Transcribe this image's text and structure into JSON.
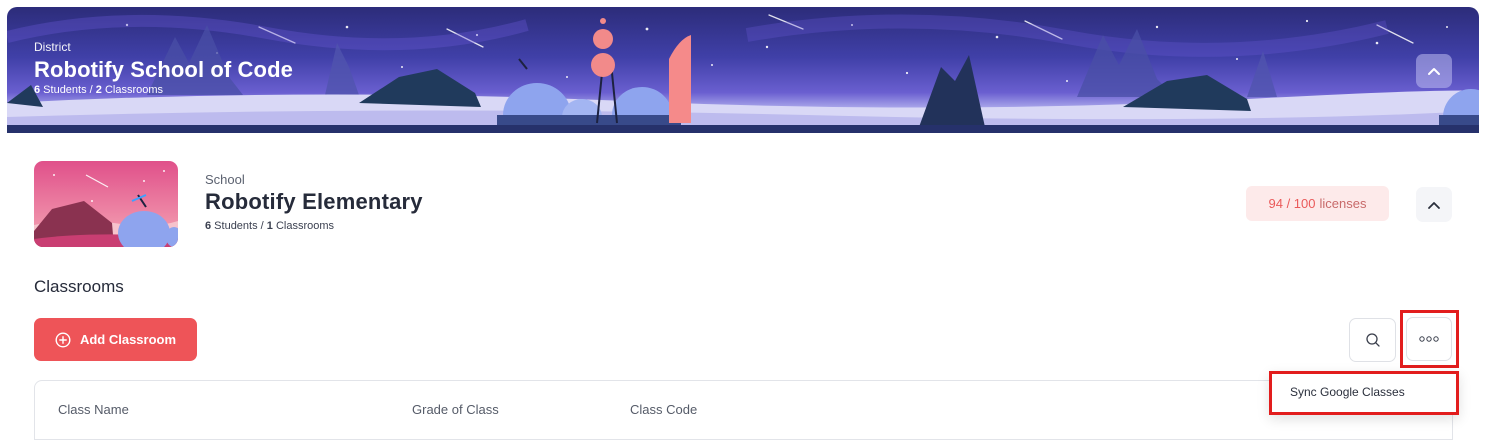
{
  "district": {
    "label": "District",
    "title": "Robotify School of Code",
    "students_count": "6",
    "students_label": " Students / ",
    "classrooms_count": "2",
    "classrooms_label": " Classrooms"
  },
  "school": {
    "label": "School",
    "title": "Robotify Elementary",
    "students_count": "6",
    "students_label": " Students / ",
    "classrooms_count": "1",
    "classrooms_label": " Classrooms",
    "licenses_used": "94 / 100",
    "licenses_label": "licenses"
  },
  "classrooms": {
    "title": "Classrooms",
    "add_button_label": "Add Classroom",
    "columns": [
      "Class Name",
      "Grade of Class",
      "Class Code"
    ]
  },
  "menu": {
    "items": [
      "Sync Google Classes"
    ]
  },
  "colors": {
    "accent": "#ee5458",
    "license_badge_bg": "#fdeaea",
    "license_badge_text": "#ea5a5a",
    "highlight": "#e21d1d"
  }
}
